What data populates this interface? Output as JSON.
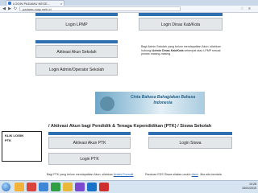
{
  "browser": {
    "tab_title": "LOGIN PADAMU NEGE...",
    "tab_close": "x",
    "url": "padamu.siap.web.id",
    "back": "◀",
    "forward": "▶",
    "reload": "↻",
    "star": "☆",
    "menu": "≡"
  },
  "buttons": {
    "login_lpmp": "Login LPMP",
    "login_dinas": "Login Dinas Kab/Kota",
    "aktivasi_sekolah": "Aktivasi Akun Sekolah",
    "login_admin": "Login Admin/Operator Sekolah",
    "aktivasi_ptk": "Aktivasi Akun PTK",
    "login_ptk": "Login PTK",
    "login_siswa": "Login Siswa"
  },
  "info": {
    "line1": "Bagi Admin Sekolah yang belum mendapatkan Akun, silahkan",
    "line2_pre": "hubungi ",
    "line2_bold": "Admin Dinas Kab/Kota",
    "line2_post": " setempat atau LPMP sesuai",
    "line3": "proses masing-masing."
  },
  "banner": {
    "text": "Cinta Bahasa Bahagiakan Bahasa Indonesia"
  },
  "section": {
    "title": "/ Aktivasi Akun bagi Pendidik & Tenaga Kependidikan (PTK) / Siswa Sekolah"
  },
  "callout": {
    "line1": "KLIK LOGIN",
    "line2": "PTK"
  },
  "footer": {
    "left_pre": "Bagi PTK yang belum mendapatkan Akun, silahkan ",
    "left_link": "Unduh Formulir",
    "right_pre": "Panduan EDS Siswa silakan unduh ",
    "right_link": "disini",
    "right_post": ". Jika ada kendala"
  },
  "taskbar": {
    "time": "10:28",
    "date": "15/01/2015"
  },
  "colors": {
    "accent": "#2d6fb0",
    "button_bg": "#e4e7ea"
  }
}
